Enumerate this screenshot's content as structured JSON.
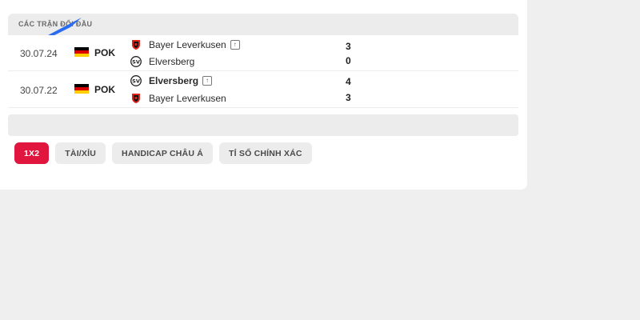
{
  "section": {
    "title": "CÁC TRẬN ĐỐI ĐẦU"
  },
  "matches": [
    {
      "date": "30.07.24",
      "league": "POK",
      "home": {
        "name": "Bayer Leverkusen",
        "score": "3",
        "winner": false,
        "has_promo_icon": true
      },
      "away": {
        "name": "Elversberg",
        "score": "0",
        "winner": false,
        "has_promo_icon": false
      }
    },
    {
      "date": "30.07.22",
      "league": "POK",
      "home": {
        "name": "Elversberg",
        "score": "4",
        "winner": true,
        "has_promo_icon": true
      },
      "away": {
        "name": "Bayer Leverkusen",
        "score": "3",
        "winner": false,
        "has_promo_icon": false
      }
    }
  ],
  "tabs": [
    {
      "label": "1X2",
      "active": true
    },
    {
      "label": "TÀI/XỈU",
      "active": false
    },
    {
      "label": "HANDICAP CHÂU Á",
      "active": false
    },
    {
      "label": "TỈ SỐ CHÍNH XÁC",
      "active": false
    }
  ],
  "colors": {
    "accent": "#e0163f",
    "header_bg": "#ececec",
    "page_bg": "#efefef",
    "card_bg": "#ffffff"
  },
  "icons": {
    "flag": "germany-flag-icon",
    "leverkusen": "bayer-leverkusen-logo-icon",
    "elversberg": "elversberg-logo-icon",
    "promo": "arrow-up-box-icon"
  }
}
